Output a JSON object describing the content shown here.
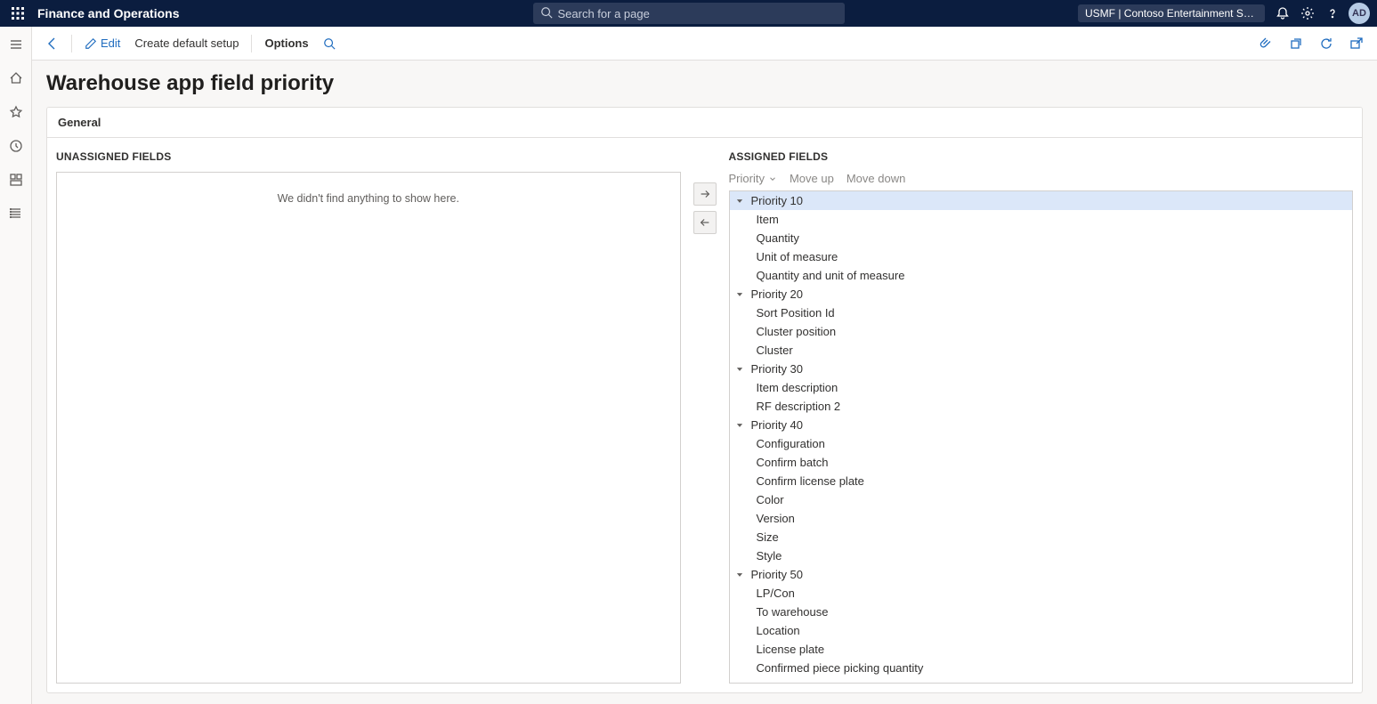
{
  "topbar": {
    "brand": "Finance and Operations",
    "search_placeholder": "Search for a page",
    "company_text": "USMF | Contoso Entertainment Syste...",
    "avatar_initials": "AD"
  },
  "actionbar": {
    "edit_label": "Edit",
    "create_label": "Create default setup",
    "options_label": "Options"
  },
  "page": {
    "title": "Warehouse app field priority",
    "section_header": "General",
    "unassigned_title": "UNASSIGNED FIELDS",
    "assigned_title": "ASSIGNED FIELDS",
    "empty_message": "We didn't find anything to show here.",
    "priority_label": "Priority",
    "moveup_label": "Move up",
    "movedown_label": "Move down"
  },
  "assigned": [
    {
      "group": "Priority 10",
      "selected": true,
      "items": [
        "Item",
        "Quantity",
        "Unit of measure",
        "Quantity and unit of measure"
      ]
    },
    {
      "group": "Priority 20",
      "selected": false,
      "items": [
        "Sort Position Id",
        "Cluster position",
        "Cluster"
      ]
    },
    {
      "group": "Priority 30",
      "selected": false,
      "items": [
        "Item description",
        "RF description 2"
      ]
    },
    {
      "group": "Priority 40",
      "selected": false,
      "items": [
        "Configuration",
        "Confirm batch",
        "Confirm license plate",
        "Color",
        "Version",
        "Size",
        "Style"
      ]
    },
    {
      "group": "Priority 50",
      "selected": false,
      "items": [
        "LP/Con",
        "To warehouse",
        "Location",
        "License plate",
        "Confirmed piece picking quantity"
      ]
    }
  ]
}
